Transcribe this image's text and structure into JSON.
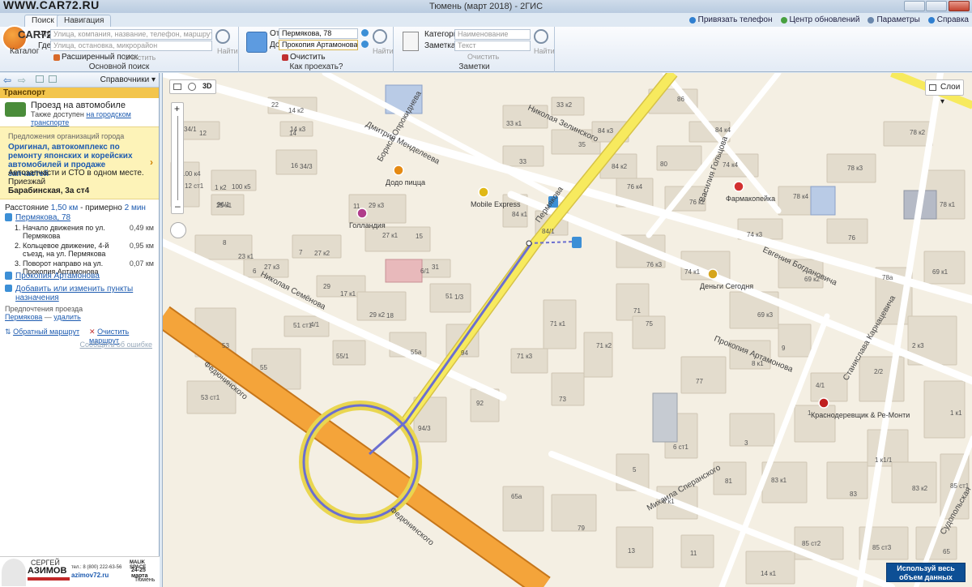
{
  "window": {
    "watermark": "WWW.CAR72.RU",
    "title": "Тюмень (март 2018) - 2ГИС"
  },
  "tabs": [
    {
      "label": "Поиск",
      "active": true
    },
    {
      "label": "Навигация",
      "active": false
    }
  ],
  "top_links": {
    "phone": "Привязать телефон",
    "updates": "Центр обновлений",
    "params": "Параметры",
    "help": "Справка"
  },
  "search_group": {
    "logo": "CAR72.RO",
    "what_label": "Что",
    "what_placeholder": "Улица, компания, название, телефон, маршрут",
    "where_label": "Где",
    "where_placeholder": "Улица, остановка, микрорайон",
    "catalog": "Каталог",
    "advanced": "Расширенный поиск",
    "clear": "Очистить",
    "find": "Найти",
    "caption": "Основной поиск"
  },
  "route_group": {
    "from_label": "От",
    "from_value": "Пермякова, 78",
    "to_label": "До",
    "to_value": "Прокопия Артамонова",
    "clear": "Очистить",
    "find": "Найти",
    "caption": "Как проехать?"
  },
  "notes_group": {
    "category_label": "Категория",
    "category_placeholder": "Наименование",
    "note_label": "Заметка",
    "note_placeholder": "Текст",
    "clear": "Очистить",
    "find": "Найти",
    "caption": "Заметки"
  },
  "sidebar": {
    "directory": "Справочники",
    "section": "Транспорт",
    "transport_title": "Проезд на автомобиле",
    "transport_sub": "Также доступен",
    "transport_link": "на городском транспорте",
    "promo_label": "Предложения организаций города",
    "promo_title": "Оригинал, автокомплекс по ремонту японских и корейских автомобилей и продаже запчастей",
    "promo_desc": "Автозапчасти и СТО в одном месте. Приезжай",
    "promo_addr": "Барабинская, 3а ст4",
    "distance_label": "Расстояние",
    "distance": "1,50 км",
    "about": "- примерно",
    "duration": "2 мин",
    "start": "Пермякова, 78",
    "steps": [
      {
        "n": "1.",
        "text": "Начало движения по ул. Пермякова",
        "dist": "0,49 км"
      },
      {
        "n": "2.",
        "text": "Кольцевое движение, 4-й съезд, на ул. Пермякова",
        "dist": "0,95 км"
      },
      {
        "n": "3.",
        "text": "Поворот направо на ул. Прокопия Артамонова",
        "dist": "0,07 км"
      }
    ],
    "end": "Прокопия Артамонова",
    "add_points": "Добавить или изменить пункты назначения",
    "prefs_title": "Предпочтения проезда",
    "prefs_street": "Пермякова",
    "prefs_delete": "удалить",
    "reverse": "Обратный маршрут",
    "clear_route": "Очистить маршрут",
    "report": "Сообщить об ошибке"
  },
  "ad": {
    "name1": "СЕРГЕЙ",
    "name2": "АЗИМОВ",
    "phone": "тел.: 8 (800) 222-63-56",
    "site": "azimov72.ru",
    "brand": "MALIK SPACE",
    "dates": "24-25 марта",
    "city": "Тюмень"
  },
  "map": {
    "layers": "Слои",
    "mode_3d": "3D",
    "promo": "Используй весь объем данных",
    "streets": [
      "Николая Зелинского",
      "Дмитрия Менделеева",
      "Бориса Опрокиднева",
      "Пермякова",
      "Николая Семёнова",
      "Федюнинского",
      "Федюнинского",
      "Прокопия Артамонова",
      "Евгения Богдановича",
      "Михаила Сперанского",
      "Станислава Карнацевича",
      "Василия Гольцова",
      "Судопольская"
    ],
    "pois": [
      "Додо пицца",
      "Mobile Express",
      "Голландия",
      "Фармакопейка",
      "Деньги Сегодня",
      "Краснодеревщик & Ре-Монти"
    ],
    "house_numbers": [
      "22",
      "14",
      "16",
      "12",
      "12 ст1",
      "1 к2",
      "25 к1",
      "23 к1",
      "27 к3",
      "27 к2",
      "29 к3",
      "27 к1",
      "29",
      "29 к2",
      "31",
      "51",
      "51 ст1",
      "53",
      "55",
      "53 ст1",
      "55/1",
      "55а",
      "94",
      "94/3",
      "92",
      "33 к1",
      "33 к2",
      "35",
      "33",
      "84 к3",
      "84 к2",
      "84 к1",
      "84/1",
      "86",
      "84 к4",
      "80",
      "74 к4",
      "76 к4",
      "76 к2",
      "76 к3",
      "74 к1",
      "74 к3",
      "78 к4",
      "78 к3",
      "78 к2",
      "78 к1",
      "76",
      "78а",
      "69 к1",
      "69 к2",
      "69 к3",
      "71",
      "71 к1",
      "71 к2",
      "71 к3",
      "73",
      "75",
      "77",
      "6 ст1",
      "8 к1",
      "9",
      "4/1",
      "2/2",
      "2 к3",
      "1 к1",
      "1 к1/1",
      "1",
      "3",
      "5",
      "6 к1",
      "81",
      "83 к1",
      "83",
      "83 к2",
      "85 ст1",
      "85 ст2",
      "85 ст3",
      "65",
      "65а",
      "79",
      "13",
      "11",
      "14 к1",
      "14 к2",
      "14 к3",
      "34/3",
      "34/1",
      "100 к4",
      "100 к5",
      "96/1",
      "8",
      "6",
      "7",
      "11",
      "15",
      "17 к1",
      "18",
      "6/1",
      "1/3",
      "4/1"
    ]
  }
}
